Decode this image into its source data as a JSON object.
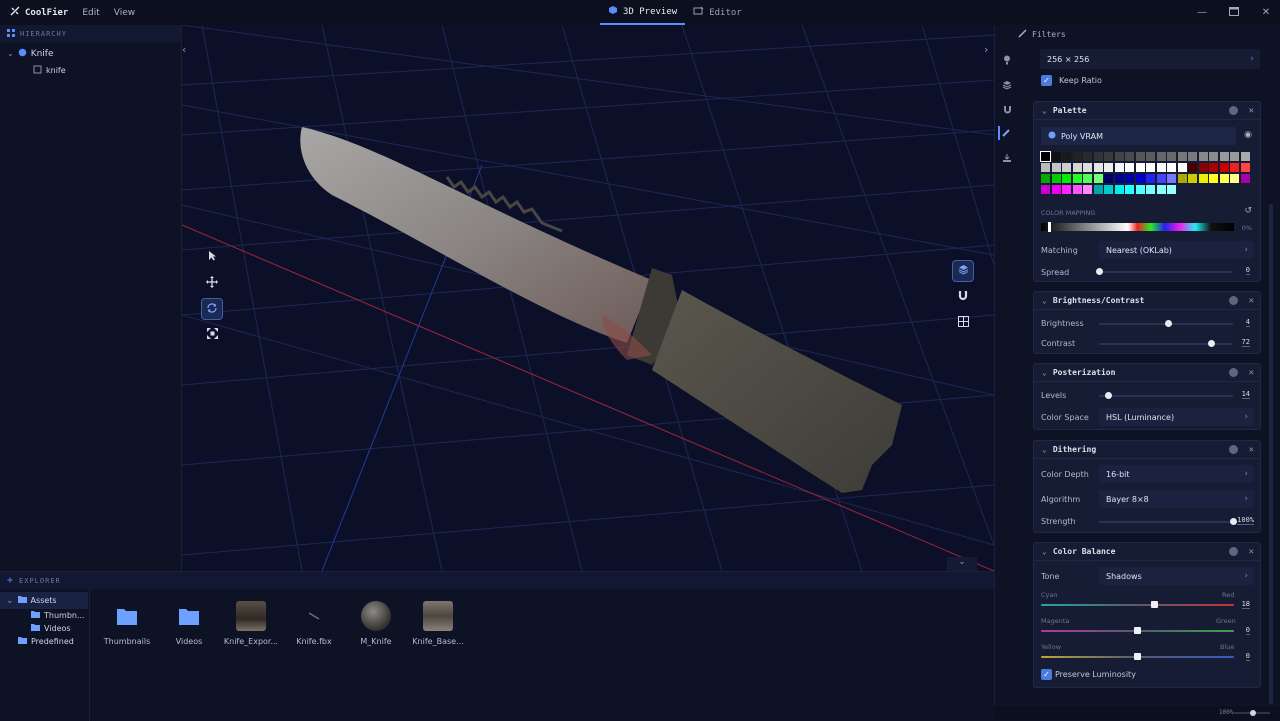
{
  "app": {
    "name": "CoolFier",
    "menu": [
      "Edit",
      "View"
    ],
    "tabs": [
      {
        "label": "3D Preview",
        "icon": "cube-icon",
        "active": true
      },
      {
        "label": "Editor",
        "icon": "image-edit-icon",
        "active": false
      }
    ]
  },
  "hierarchy": {
    "title": "HIERARCHY",
    "items": [
      {
        "label": "Knife",
        "level": 0,
        "expanded": true
      },
      {
        "label": "knife",
        "level": 1
      }
    ]
  },
  "viewport": {
    "tools": [
      "select-tool",
      "move-tool",
      "rotate-tool",
      "scale-tool"
    ],
    "active_tool": "rotate-tool",
    "right_tools": [
      "layers",
      "magnet",
      "grid"
    ]
  },
  "explorer": {
    "title": "EXPLORER",
    "tree": [
      {
        "label": "Assets",
        "level": 0,
        "selected": true
      },
      {
        "label": "Thumbn...",
        "level": 1
      },
      {
        "label": "Videos",
        "level": 1
      },
      {
        "label": "Predefined",
        "level": 0
      }
    ],
    "assets": [
      "Thumbnails",
      "Videos",
      "Knife_Expor...",
      "Knife.fbx",
      "M_Knife",
      "Knife_Base..."
    ]
  },
  "filters": {
    "title": "Filters",
    "resolution": {
      "value": "256 × 256",
      "keep_ratio_label": "Keep Ratio",
      "keep_ratio": true
    },
    "palette": {
      "title": "Palette",
      "name": "Poly VRAM",
      "mapping_label": "COLOR MAPPING",
      "mapping_value": "0%",
      "matching_label": "Matching",
      "matching_value": "Nearest (OKLab)",
      "spread_label": "Spread",
      "spread_value": "0",
      "spread": 0
    },
    "brightness_contrast": {
      "title": "Brightness/Contrast",
      "brightness_label": "Brightness",
      "brightness_value": "4",
      "brightness": 0.52,
      "contrast_label": "Contrast",
      "contrast_value": "72",
      "contrast": 0.84
    },
    "posterization": {
      "title": "Posterization",
      "levels_label": "Levels",
      "levels_value": "14",
      "levels": 0.07,
      "colorspace_label": "Color Space",
      "colorspace_value": "HSL (Luminance)"
    },
    "dithering": {
      "title": "Dithering",
      "depth_label": "Color Depth",
      "depth_value": "16-bit",
      "algorithm_label": "Algorithm",
      "algorithm_value": "Bayer 8×8",
      "strength_label": "Strength",
      "strength_value": "100%",
      "strength": 1.0
    },
    "color_balance": {
      "title": "Color Balance",
      "tone_label": "Tone",
      "tone_value": "Shadows",
      "cyan": "Cyan",
      "red": "Red",
      "cr_value": "18",
      "magenta": "Magenta",
      "green": "Green",
      "mg_value": "0",
      "yellow": "Yellow",
      "blue": "Blue",
      "yb_value": "0",
      "preserve_label": "Preserve Luminosity",
      "preserve": true
    }
  },
  "status": {
    "zoom": "100%"
  },
  "colors": {
    "accent": "#5a8dff",
    "panel": "#0d1224",
    "card": "#161c33"
  }
}
